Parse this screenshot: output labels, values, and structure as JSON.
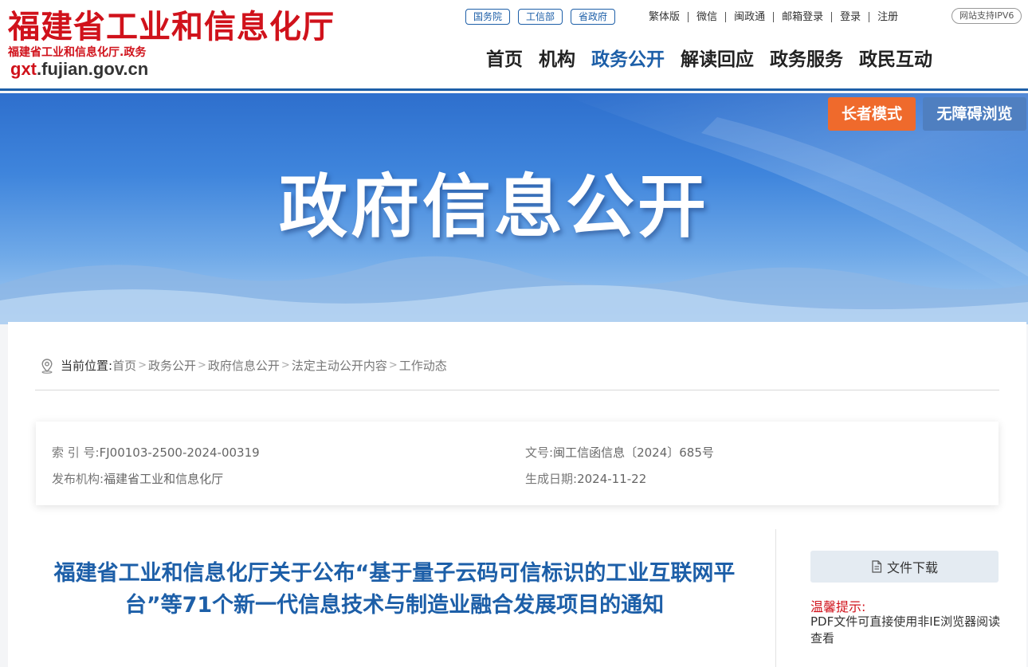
{
  "header": {
    "logo_cn": "福建省工业和信息化厅",
    "logo_sub": "福建省工业和信息化厅.政务",
    "logo_domain_prefix": "gxt",
    "logo_domain_rest": ".fujian.gov.cn",
    "pills": [
      "国务院",
      "工信部",
      "省政府"
    ],
    "utility_links": [
      "繁体版",
      "微信",
      "闽政通",
      "邮箱登录",
      "登录",
      "注册"
    ],
    "ipv6_badge": "网站支持IPV6",
    "nav": [
      "首页",
      "机构",
      "政务公开",
      "解读回应",
      "政务服务",
      "政民互动"
    ],
    "nav_active": "政务公开"
  },
  "banner": {
    "title": "政府信息公开",
    "elder_mode": "长者模式",
    "accessibility": "无障碍浏览"
  },
  "breadcrumb": {
    "label": "当前位置:",
    "items": [
      "首页",
      "政务公开",
      "政府信息公开",
      "法定主动公开内容",
      "工作动态"
    ],
    "separator": ">"
  },
  "meta": {
    "index_label": "索 引 号:",
    "index_value": "FJ00103-2500-2024-00319",
    "doc_label": "文号:",
    "doc_value": "闽工信函信息〔2024〕685号",
    "publisher_label": "发布机构:",
    "publisher_value": "福建省工业和信息化厅",
    "date_label": "生成日期:",
    "date_value": "2024-11-22"
  },
  "article": {
    "title": "福建省工业和信息化厅关于公布“基于量子云码可信标识的工业互联网平台”等71个新一代信息技术与制造业融合发展项目的通知"
  },
  "sidebar": {
    "download_label": "文件下载",
    "tip_title": "温馨提示:",
    "tip_text": "PDF文件可直接使用非IE浏览器阅读查看"
  },
  "colors": {
    "brand_red": "#d0121b",
    "brand_blue": "#1d5fa8",
    "elder_orange": "#ef6a2c"
  }
}
